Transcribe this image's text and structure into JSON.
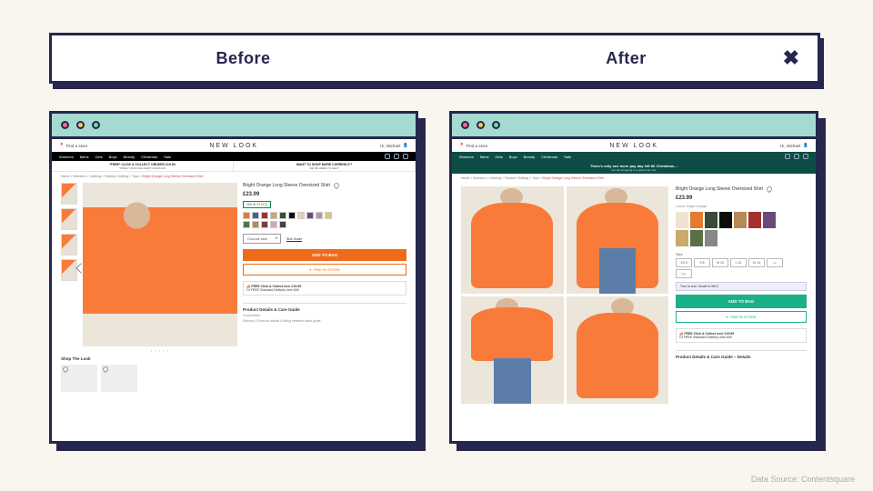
{
  "header": {
    "before_label": "Before",
    "after_label": "After"
  },
  "footer": {
    "source": "Data Source: Contentsquare"
  },
  "store": {
    "brand": "NEW LOOK",
    "locator": "Find a store",
    "account": "Hi, Michael",
    "nav": [
      "Womens",
      "Mens",
      "Girls",
      "Boys",
      "Beauty",
      "Christmas",
      "Sale"
    ],
    "breadcrumbs": "Home > Womens > Clothing > Fashion Clothing > Tops >",
    "breadcrumb_current": "Bright Orange Long Sleeve Oversized Shirt"
  },
  "before": {
    "promo1": {
      "title": "*FREE* CLICK & COLLECT ORDERS £19.99",
      "sub": "*FREE* UKRH DELIVERY OVER £45"
    },
    "promo2": {
      "title": "WANT TO SHOP MORE CURRENCY?",
      "sub": "WE'RE HERE TO HELP"
    },
    "product": {
      "title": "Bright Orange Long Sleeve Oversized Shirt",
      "price": "£23.99",
      "stock": "256 IN STOCK",
      "swatch_colors": [
        "#e67a2e",
        "#3b6b8c",
        "#a42f2f",
        "#caa96b",
        "#3c4a3a",
        "#0c0c0c",
        "#e3d0be",
        "#6b4a7a",
        "#a8a099",
        "#d8c87a",
        "#5a6f43",
        "#b88856",
        "#7b3f3f",
        "#cfa8c0",
        "#444"
      ],
      "size_label": "Choose size",
      "size_guide": "Size Guide",
      "add_to_bag": "ADD TO BAG",
      "find_store": "FIND IN STORE",
      "ship_title": "FREE Click & Collect over £19.99",
      "ship_sub": "Or FREE Standard Delivery over £45",
      "details_head": "Product Details & Care Guide",
      "details_sub1": "Composition",
      "details_sub2": "Delivery & Returns details & fitting between sizes guide",
      "shop_the_look": "Shop The Look"
    }
  },
  "after": {
    "banner_title": "There's only one more pay day left till Christmas…",
    "banner_sub": "Get gift-wrapping & a special sip now",
    "product": {
      "title": "Bright Orange Long Sleeve Oversized Shirt",
      "price": "£23.99",
      "colour_label": "Colour: Bright Orange",
      "variant_colors": [
        "#f0e3cf",
        "#e67a2e",
        "#3c4a3a",
        "#0c0c0c",
        "#b88856",
        "#a42f2f",
        "#6b4a7a",
        "#caa96b",
        "#5a6f43",
        "#888"
      ],
      "size_label": "Size",
      "sizes": [
        "XS 6",
        "S 8",
        "M 10",
        "L 12",
        "XL 14",
        "2L",
        "3XL"
      ],
      "fit_note": "True to size. Model is 5ft10",
      "add_to_bag": "ADD TO BAG",
      "find_store": "FIND IN STORE",
      "ship_title": "FREE Click & Collect over £19.99",
      "ship_sub": "Or FREE Standard Delivery over £45",
      "details_head": "Product Details & Care Guide – Details"
    }
  }
}
